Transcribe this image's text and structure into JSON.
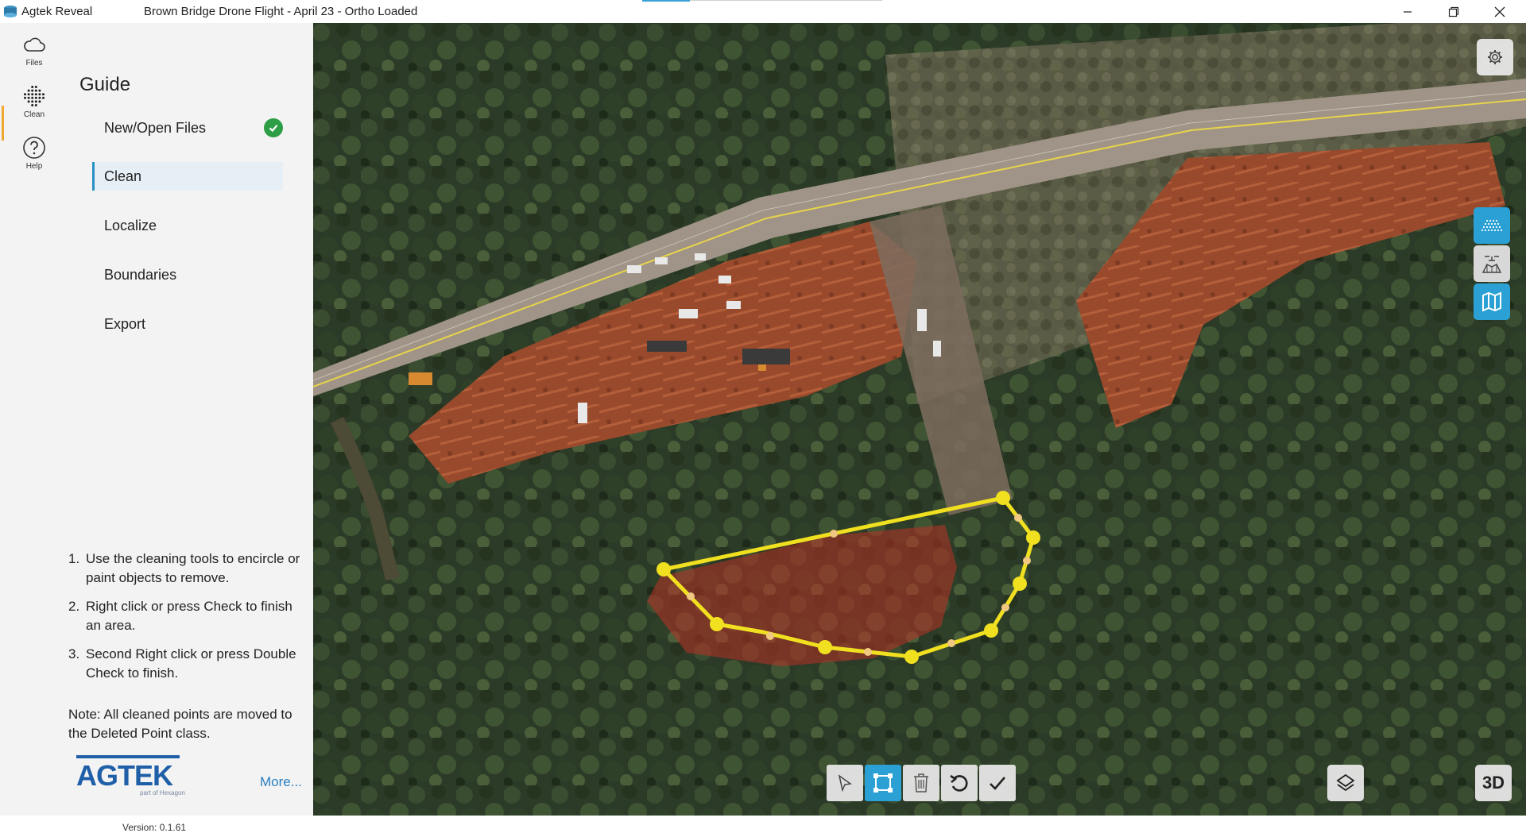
{
  "window": {
    "app_name": "Agtek Reveal",
    "title": "Brown Bridge Drone Flight - April 23 - Ortho Loaded"
  },
  "rail": {
    "items": [
      {
        "label": "Files",
        "icon": "cloud-icon"
      },
      {
        "label": "Clean",
        "icon": "point-cloud-icon",
        "active": true
      },
      {
        "label": "Help",
        "icon": "help-icon"
      }
    ]
  },
  "guide": {
    "title": "Guide",
    "steps": [
      {
        "label": "New/Open Files",
        "done": true
      },
      {
        "label": "Clean",
        "active": true
      },
      {
        "label": "Localize"
      },
      {
        "label": "Boundaries"
      },
      {
        "label": "Export"
      }
    ],
    "instructions": [
      {
        "num": "1.",
        "text": "Use the cleaning tools to encircle or paint objects to remove."
      },
      {
        "num": "2.",
        "text": "Right click or press Check to finish an area."
      },
      {
        "num": "3.",
        "text": "Second Right click or press Double Check to finish."
      }
    ],
    "note": "Note: All cleaned points are moved to the Deleted Point class.",
    "more_label": "More...",
    "version": "Version: 0.1.61",
    "logo_text": "AGTEK",
    "logo_sub": "part of Hexagon"
  },
  "map": {
    "side_buttons": [
      {
        "icon": "point-cloud-view-icon",
        "color": "#2aa0d4"
      },
      {
        "icon": "drone-view-icon",
        "color": "#d8d8d8"
      },
      {
        "icon": "map-view-icon",
        "color": "#2aa0d4"
      }
    ],
    "toolbar": [
      {
        "icon": "select-arrow-icon",
        "active": false
      },
      {
        "icon": "polygon-select-icon",
        "active": true
      },
      {
        "icon": "trash-icon",
        "active": false
      },
      {
        "icon": "undo-icon",
        "active": false
      },
      {
        "icon": "check-icon",
        "active": false
      }
    ],
    "three_d_label": "3D",
    "accent_color": "#2aa0d4",
    "selection_color": "#f0e020"
  }
}
